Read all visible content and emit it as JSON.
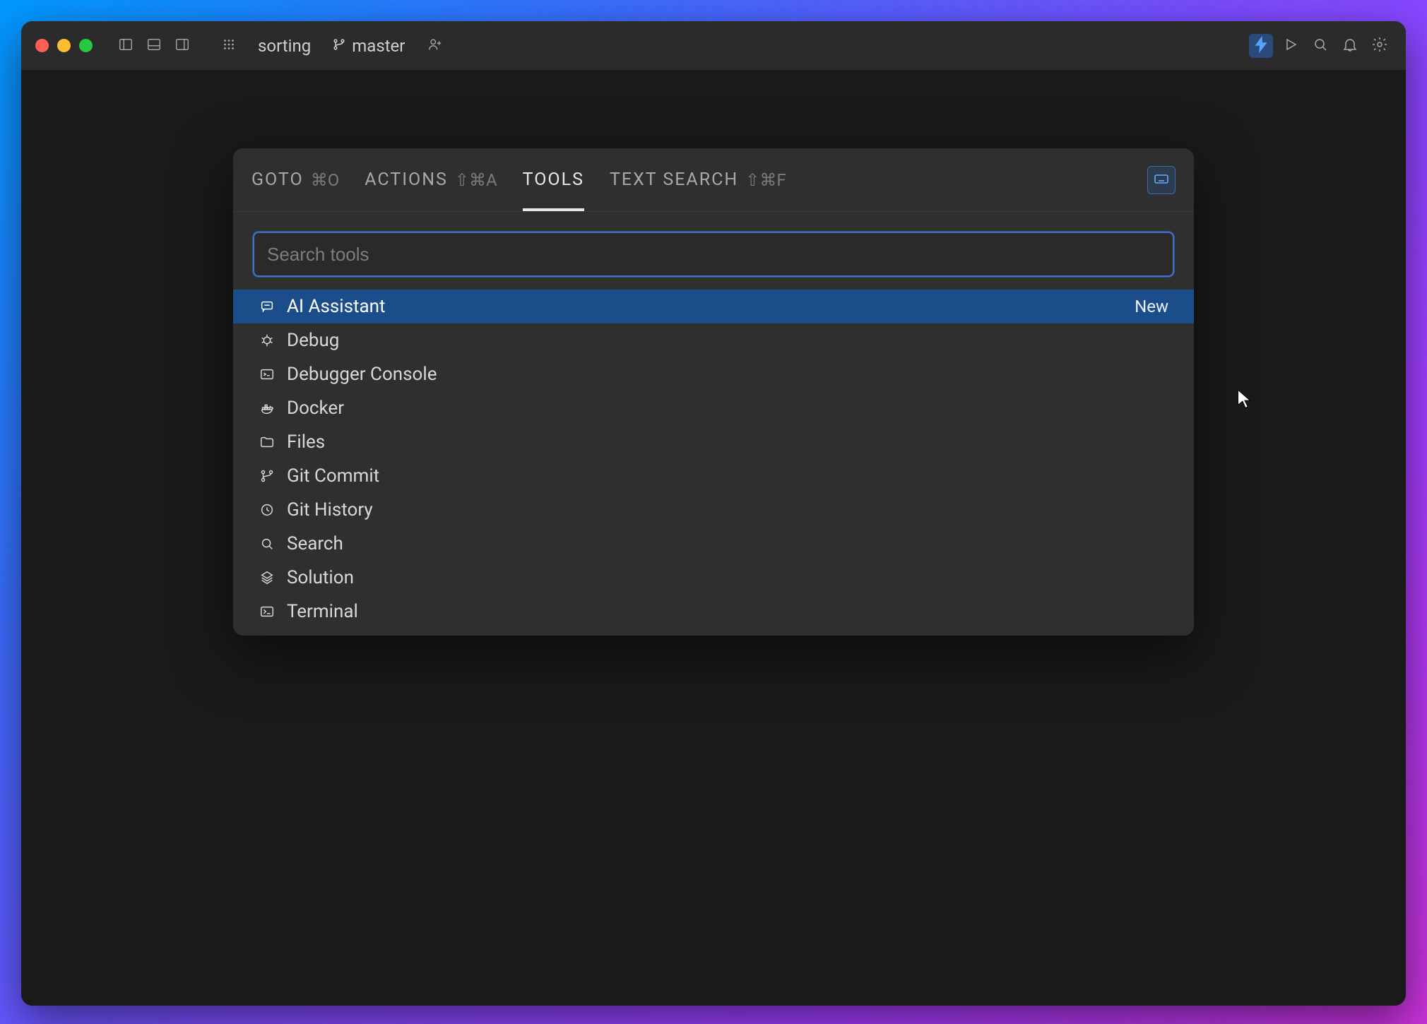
{
  "window": {
    "project": "sorting",
    "branch": "master"
  },
  "palette": {
    "tabs": [
      {
        "label": "GOTO",
        "shortcut": "⌘O",
        "active": false
      },
      {
        "label": "ACTIONS",
        "shortcut": "⇧⌘A",
        "active": false
      },
      {
        "label": "TOOLS",
        "shortcut": "",
        "active": true
      },
      {
        "label": "TEXT SEARCH",
        "shortcut": "⇧⌘F",
        "active": false
      }
    ],
    "search_placeholder": "Search tools",
    "search_value": "",
    "results": [
      {
        "icon": "chat",
        "label": "AI Assistant",
        "badge": "New",
        "selected": true
      },
      {
        "icon": "bug",
        "label": "Debug",
        "badge": "",
        "selected": false
      },
      {
        "icon": "console",
        "label": "Debugger Console",
        "badge": "",
        "selected": false
      },
      {
        "icon": "docker",
        "label": "Docker",
        "badge": "",
        "selected": false
      },
      {
        "icon": "folder",
        "label": "Files",
        "badge": "",
        "selected": false
      },
      {
        "icon": "branch",
        "label": "Git Commit",
        "badge": "",
        "selected": false
      },
      {
        "icon": "clock",
        "label": "Git History",
        "badge": "",
        "selected": false
      },
      {
        "icon": "search",
        "label": "Search",
        "badge": "",
        "selected": false
      },
      {
        "icon": "solution",
        "label": "Solution",
        "badge": "",
        "selected": false
      },
      {
        "icon": "terminal",
        "label": "Terminal",
        "badge": "",
        "selected": false
      }
    ]
  }
}
